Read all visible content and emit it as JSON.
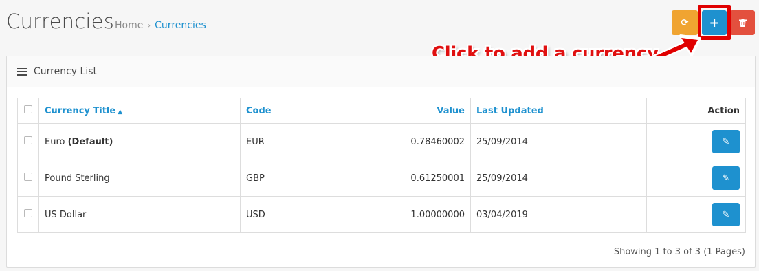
{
  "header": {
    "title": "Currencies",
    "breadcrumb": {
      "home": "Home",
      "separator": "›",
      "current": "Currencies"
    },
    "buttons": [
      {
        "name": "refresh",
        "icon": "refresh-icon",
        "glyph": "⟳",
        "color": "#f0a431"
      },
      {
        "name": "add",
        "icon": "plus-icon",
        "glyph": "+",
        "color": "#1e91cf"
      },
      {
        "name": "delete",
        "icon": "trash-icon",
        "glyph": "🗑",
        "color": "#e3503e"
      }
    ]
  },
  "annotation": {
    "text": "Click to add a currency",
    "color": "#e00000"
  },
  "panel": {
    "title": "Currency List",
    "icon": "list-icon"
  },
  "table": {
    "headers": {
      "title": "Currency Title",
      "title_sort_icon": "▲",
      "code": "Code",
      "value": "Value",
      "last_updated": "Last Updated",
      "action": "Action"
    },
    "rows": [
      {
        "title": "Euro",
        "suffix": "(Default)",
        "code": "EUR",
        "value": "0.78460002",
        "last_updated": "25/09/2014"
      },
      {
        "title": "Pound Sterling",
        "suffix": "",
        "code": "GBP",
        "value": "0.61250001",
        "last_updated": "25/09/2014"
      },
      {
        "title": "US Dollar",
        "suffix": "",
        "code": "USD",
        "value": "1.00000000",
        "last_updated": "03/04/2019"
      }
    ],
    "edit_icon": "pencil-icon",
    "edit_glyph": "✎"
  },
  "pagination": {
    "showing": "Showing 1 to 3 of 3 (1 Pages)"
  }
}
